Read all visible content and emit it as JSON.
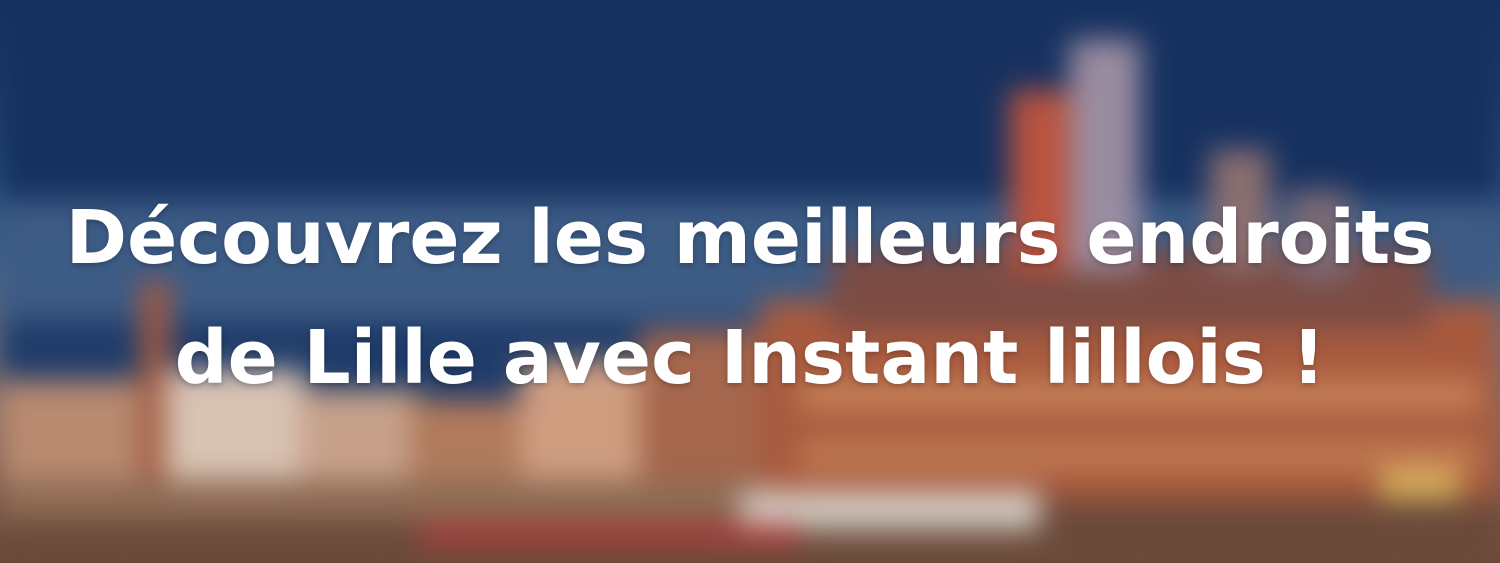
{
  "hero": {
    "line1": "Découvrez les meilleurs endroits",
    "line2": "de Lille avec Instant lillois !"
  },
  "colors": {
    "sky_top": "#15305b",
    "sky_mid": "#3e5f86",
    "building_brick": "#a0553d",
    "building_stone": "#c9a98d",
    "text": "#ffffff"
  }
}
